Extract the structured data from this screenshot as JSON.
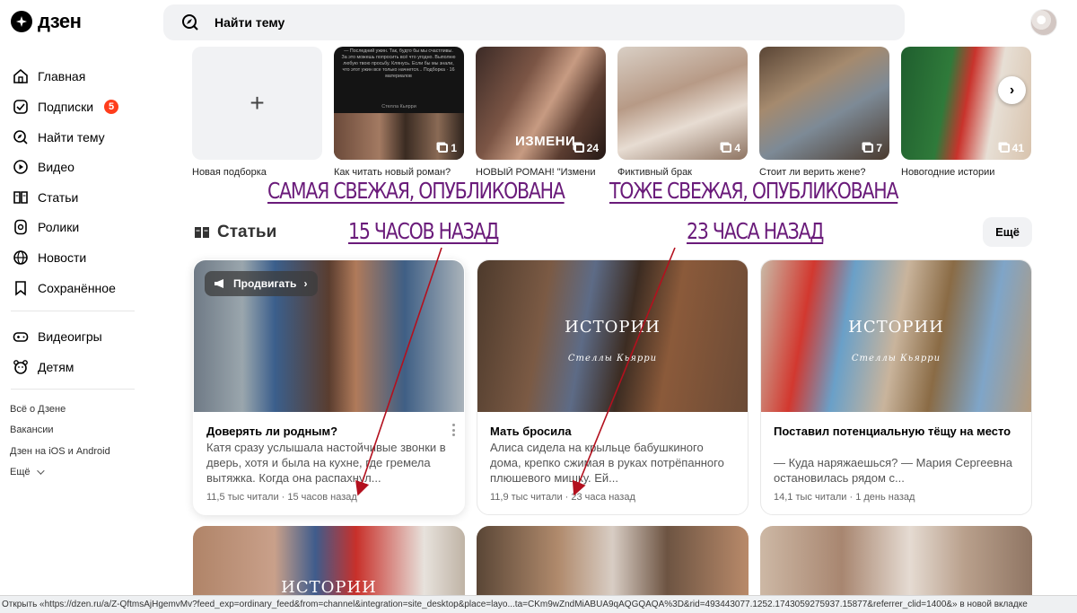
{
  "header": {
    "logo_text": "дзен",
    "search_placeholder": "Найти тему"
  },
  "sidebar": {
    "items": [
      {
        "label": "Главная",
        "icon": "home-icon"
      },
      {
        "label": "Подписки",
        "icon": "subscriptions-icon",
        "badge": "5"
      },
      {
        "label": "Найти тему",
        "icon": "compass-icon"
      },
      {
        "label": "Видео",
        "icon": "play-icon"
      },
      {
        "label": "Статьи",
        "icon": "book-icon"
      },
      {
        "label": "Ролики",
        "icon": "shorts-icon"
      },
      {
        "label": "Новости",
        "icon": "news-icon"
      },
      {
        "label": "Сохранённое",
        "icon": "bookmark-icon"
      },
      {
        "label": "Видеоигры",
        "icon": "gamepad-icon"
      },
      {
        "label": "Детям",
        "icon": "bear-icon"
      }
    ],
    "links": [
      "Всё о Дзене",
      "Вакансии",
      "Дзен на iOS и Android",
      "Ещё"
    ]
  },
  "collections": {
    "new_label": "Новая подборка",
    "items": [
      {
        "label": "Как читать новый роман?",
        "count": "1"
      },
      {
        "label": "НОВЫЙ РОМАН! \"Измени",
        "count": "24",
        "overlay": "ИЗМЕНИ"
      },
      {
        "label": "Фиктивный брак",
        "count": "4"
      },
      {
        "label": "Стоит ли верить жене?",
        "count": "7"
      },
      {
        "label": "Новогодние истории",
        "count": "41"
      }
    ],
    "first_thumb_text": "— Последний ужин. Так, будто бы мы счастливы. За это можешь попросить всё что угодно. Выполню любую твою просьбу. Клянусь. Если бы мы знали, что этот ужин все только начнется... Подборка · 16 материалов",
    "first_thumb_author": "Стелла Кьярри"
  },
  "annotations": {
    "left_line1": "Самая свежая, опубликована",
    "left_line2": "15 часов назад",
    "right_line1": "Тоже свежая, опубликована",
    "right_line2": "23 часа назад",
    "color": "#6a1b7a"
  },
  "articles_section": {
    "title": "Статьи",
    "more_label": "Ещё"
  },
  "cards": [
    {
      "promote_label": "Продвигать",
      "title": "Доверять ли родным?",
      "snippet": "Катя сразу услышала настойчивые звонки в дверь, хотя и была на кухне, где гремела вытяжка. Когда она распахнул...",
      "meta": "11,5 тыс читали · 15 часов назад"
    },
    {
      "stories_title": "ИСТОРИИ",
      "stories_sub": "Стеллы Кьярри",
      "title": "Мать бросила",
      "snippet": "Алиса сидела на крыльце бабушкиного дома, крепко сжимая в руках потрёпанного плюшевого мишку. Ей...",
      "meta": "11,9 тыс читали · 23 часа назад"
    },
    {
      "stories_title": "ИСТОРИИ",
      "stories_sub": "Стеллы Кьярри",
      "title": "Поставил потенциальную тёщу на место",
      "snippet": "— Куда наряжаешься? — Мария Сергеевна остановилась рядом с...",
      "meta": "14,1 тыс читали · 1 день назад"
    }
  ],
  "bottom_cards": [
    {
      "stories_title": "ИСТОРИИ"
    },
    {},
    {}
  ],
  "statusbar": "Открыть «https://dzen.ru/a/Z-QftmsAjHgemvMv?feed_exp=ordinary_feed&from=channel&integration=site_desktop&place=layo...ta=CKm9wZndMiABUA9qAQGQAQA%3D&rid=493443077.1252.1743059275937.15877&referrer_clid=1400&» в новой вкладке"
}
